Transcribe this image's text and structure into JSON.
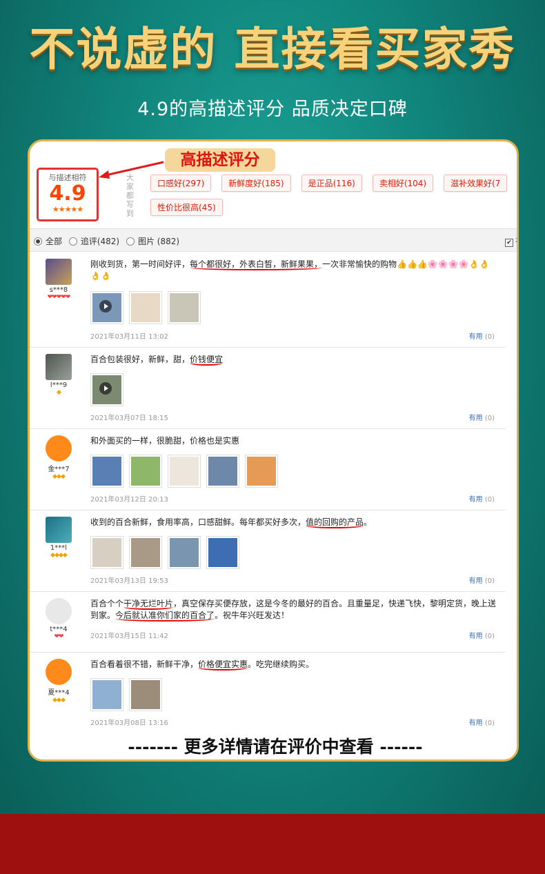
{
  "headline": "不说虚的 直接看买家秀",
  "subheadline": "4.9的高描述评分 品质决定口碑",
  "callout": "高描述评分",
  "rating": {
    "label": "与描述相符",
    "score": "4.9",
    "stars": "★★★★★"
  },
  "tags_side_label": "大家都写到",
  "tags": [
    "口感好(297)",
    "新鲜度好(185)",
    "是正品(116)",
    "卖相好(104)",
    "滋补效果好(7",
    "性价比很高(45)"
  ],
  "filters": {
    "all": "全部",
    "followup": "追评(482)",
    "photos": "图片 (882)",
    "has_image": "有"
  },
  "useful_label": "有用",
  "useful_count": "(0)",
  "reviews": [
    {
      "user": "s***8",
      "level": "❤❤❤❤❤",
      "parts": [
        "刚收到货，第一时间好评，",
        "每个都很好，外表白皙，新鲜果果，",
        "一次非常愉快的购物👍👍👍🌸🌸🌸🌸👌👌👌👌"
      ],
      "date": "2021年03月11日 13:02"
    },
    {
      "user": "l***9",
      "level": "◆",
      "parts": [
        "百合包装很好，新鲜，甜，",
        "价钱便宜",
        ""
      ],
      "date": "2021年03月07日 18:15"
    },
    {
      "user": "金***7",
      "level": "◆◆◆",
      "parts": [
        "和外面买的一样，很脆甜，价格也是实惠",
        "",
        ""
      ],
      "date": "2021年03月12日 20:13"
    },
    {
      "user": "1***l",
      "level": "◆◆◆◆",
      "parts": [
        "收到的百合新鲜，食用率高，口感甜鲜。每年都买好多次，",
        "值的回购的产品",
        "。"
      ],
      "date": "2021年03月13日 19:53"
    },
    {
      "user": "t***4",
      "level": "❤❤",
      "parts": [
        "百合个个",
        "干净无烂叶片",
        "，真空保存买便存放，这是今冬的最好的百合。且重量足，快递飞快，黎明定货，晚上送到家。",
        "今后就认准你们家的百合了",
        "。祝牛年兴旺发达！"
      ],
      "date": "2021年03月15日 11:42"
    },
    {
      "user": "夏***4",
      "level": "◆◆◆",
      "parts": [
        "百合看着很不错，新鲜干净，",
        "价格便宜实惠",
        "。吃完继续购买。"
      ],
      "date": "2021年03月08日 13:16"
    }
  ],
  "footer_note": "-------  更多详情请在评价中查看  ------"
}
